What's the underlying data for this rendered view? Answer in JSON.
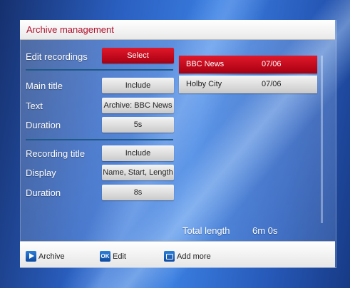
{
  "header": {
    "title": "Archive management"
  },
  "edit": {
    "label": "Edit recordings",
    "value": "Select"
  },
  "main_title": {
    "label": "Main title",
    "value": "Include",
    "text_label": "Text",
    "text_value": "Archive: BBC News",
    "duration_label": "Duration",
    "duration_value": "5s"
  },
  "recording_title": {
    "label": "Recording title",
    "value": "Include",
    "display_label": "Display",
    "display_value": "Name, Start, Length",
    "duration_label": "Duration",
    "duration_value": "8s"
  },
  "recordings": [
    {
      "name": "BBC News",
      "date": "07/06",
      "selected": true
    },
    {
      "name": "Holby City",
      "date": "07/06",
      "selected": false
    }
  ],
  "total": {
    "label": "Total length",
    "value": "6m 0s"
  },
  "footer": {
    "archive_label": "Archive",
    "edit_icon_text": "OK",
    "edit_label": "Edit",
    "add_label": "Add more"
  }
}
